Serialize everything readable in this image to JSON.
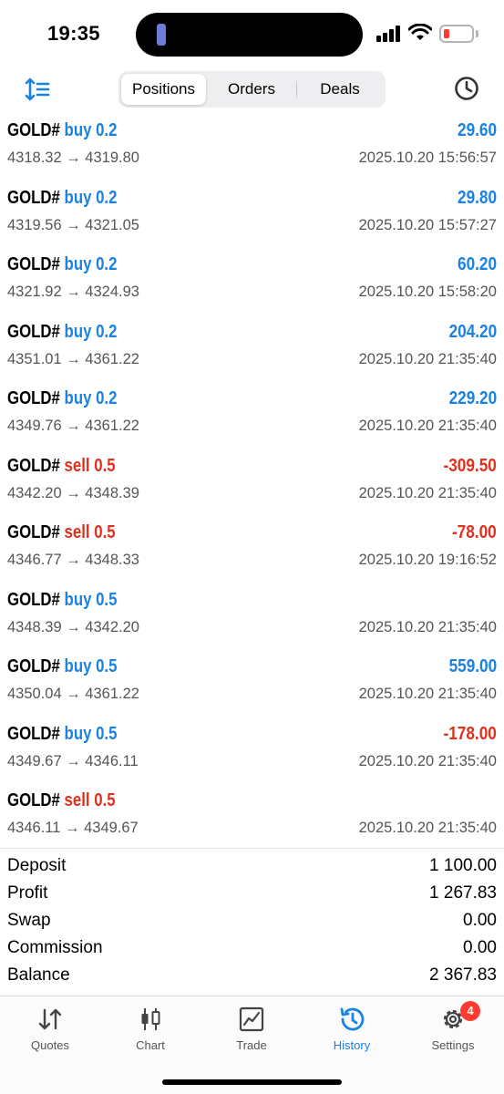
{
  "status_bar": {
    "time": "19:35"
  },
  "header": {
    "tabs": [
      {
        "label": "Positions",
        "active": true
      },
      {
        "label": "Orders",
        "active": false
      },
      {
        "label": "Deals",
        "active": false
      }
    ]
  },
  "colors": {
    "buy": "#1a82e2",
    "sell": "#e0301e",
    "accent": "#1a82e2"
  },
  "deals": [
    {
      "symbol": "GOLD#",
      "direction": "buy",
      "volume": "buy 0.2",
      "prices": "4318.32 → 4319.80",
      "datetime": "2025.10.20 15:56:57",
      "profit": "29.60",
      "profit_color": "blue"
    },
    {
      "symbol": "GOLD#",
      "direction": "buy",
      "volume": "buy 0.2",
      "prices": "4319.56 → 4321.05",
      "datetime": "2025.10.20 15:57:27",
      "profit": "29.80",
      "profit_color": "blue"
    },
    {
      "symbol": "GOLD#",
      "direction": "buy",
      "volume": "buy 0.2",
      "prices": "4321.92 → 4324.93",
      "datetime": "2025.10.20 15:58:20",
      "profit": "60.20",
      "profit_color": "blue"
    },
    {
      "symbol": "GOLD#",
      "direction": "buy",
      "volume": "buy 0.2",
      "prices": "4351.01 → 4361.22",
      "datetime": "2025.10.20 21:35:40",
      "profit": "204.20",
      "profit_color": "blue"
    },
    {
      "symbol": "GOLD#",
      "direction": "buy",
      "volume": "buy 0.2",
      "prices": "4349.76 → 4361.22",
      "datetime": "2025.10.20 21:35:40",
      "profit": "229.20",
      "profit_color": "blue"
    },
    {
      "symbol": "GOLD#",
      "direction": "sell",
      "volume": "sell 0.5",
      "prices": "4342.20 → 4348.39",
      "datetime": "2025.10.20 21:35:40",
      "profit": "-309.50",
      "profit_color": "red"
    },
    {
      "symbol": "GOLD#",
      "direction": "sell",
      "volume": "sell 0.5",
      "prices": "4346.77 → 4348.33",
      "datetime": "2025.10.20 19:16:52",
      "profit": "-78.00",
      "profit_color": "red"
    },
    {
      "symbol": "GOLD#",
      "direction": "buy",
      "volume": "buy 0.5",
      "prices": "4348.39 → 4342.20",
      "datetime": "2025.10.20 21:35:40",
      "profit": "",
      "profit_color": "blue"
    },
    {
      "symbol": "GOLD#",
      "direction": "buy",
      "volume": "buy 0.5",
      "prices": "4350.04 → 4361.22",
      "datetime": "2025.10.20 21:35:40",
      "profit": "559.00",
      "profit_color": "blue"
    },
    {
      "symbol": "GOLD#",
      "direction": "buy",
      "volume": "buy 0.5",
      "prices": "4349.67 → 4346.11",
      "datetime": "2025.10.20 21:35:40",
      "profit": "-178.00",
      "profit_color": "red"
    },
    {
      "symbol": "GOLD#",
      "direction": "sell",
      "volume": "sell 0.5",
      "prices": "4346.11 → 4349.67",
      "datetime": "2025.10.20 21:35:40",
      "profit": "",
      "profit_color": "red"
    }
  ],
  "summary": [
    {
      "label": "Deposit",
      "value": "1 100.00"
    },
    {
      "label": "Profit",
      "value": "1 267.83"
    },
    {
      "label": "Swap",
      "value": "0.00"
    },
    {
      "label": "Commission",
      "value": "0.00"
    },
    {
      "label": "Balance",
      "value": "2 367.83"
    }
  ],
  "tabbar": {
    "tabs": [
      {
        "label": "Quotes",
        "icon": "quotes-icon",
        "active": false
      },
      {
        "label": "Chart",
        "icon": "chart-icon",
        "active": false
      },
      {
        "label": "Trade",
        "icon": "trade-icon",
        "active": false
      },
      {
        "label": "History",
        "icon": "history-icon",
        "active": true
      },
      {
        "label": "Settings",
        "icon": "settings-icon",
        "active": false,
        "badge": "4"
      }
    ]
  }
}
